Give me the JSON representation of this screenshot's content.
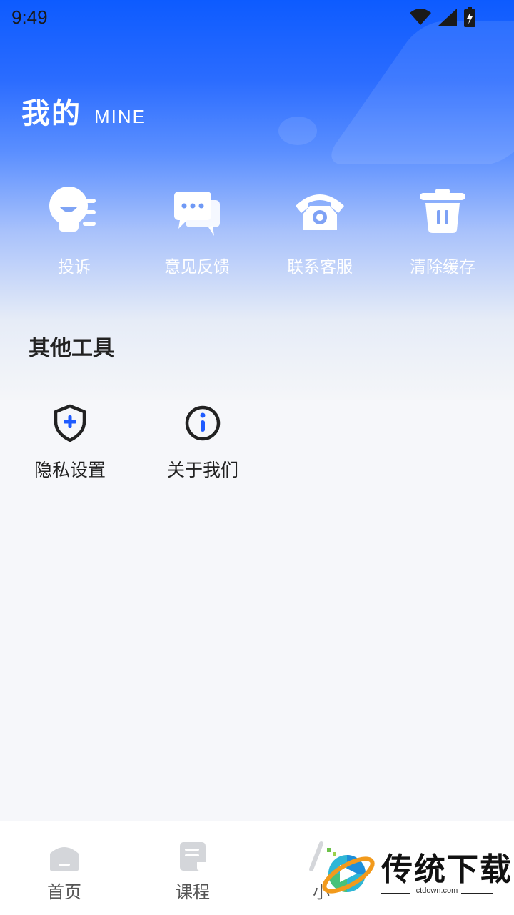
{
  "status_bar": {
    "time": "9:49"
  },
  "header": {
    "title": "我的",
    "subtitle": "MINE"
  },
  "quick_actions": [
    {
      "label": "投诉",
      "icon": "complaint-icon"
    },
    {
      "label": "意见反馈",
      "icon": "feedback-icon"
    },
    {
      "label": "联系客服",
      "icon": "phone-icon"
    },
    {
      "label": "清除缓存",
      "icon": "trash-icon"
    }
  ],
  "other_tools": {
    "title": "其他工具",
    "items": [
      {
        "label": "隐私设置",
        "icon": "privacy-shield-icon"
      },
      {
        "label": "关于我们",
        "icon": "info-icon"
      }
    ]
  },
  "tabbar": {
    "tabs": [
      {
        "label": "首页",
        "icon": "home-icon"
      },
      {
        "label": "课程",
        "icon": "course-icon"
      },
      {
        "label": "小",
        "icon": "tab3-icon"
      }
    ]
  },
  "watermark": {
    "text": "传统下载",
    "url": "ctdown.com"
  },
  "colors": {
    "accent": "#1f5bff",
    "hero_top": "#0d5bff",
    "text_dark": "#222222"
  }
}
